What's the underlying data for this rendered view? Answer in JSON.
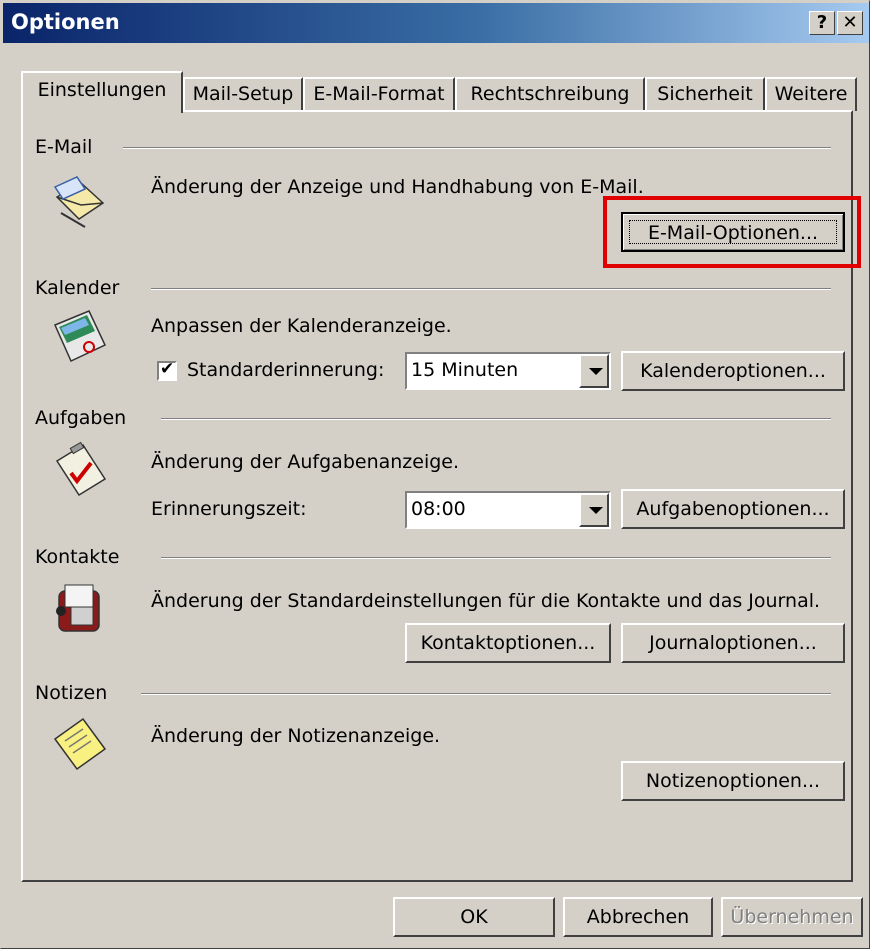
{
  "window": {
    "title": "Optionen",
    "help_label": "?",
    "close_label": "✕"
  },
  "tabs": [
    "Einstellungen",
    "Mail-Setup",
    "E-Mail-Format",
    "Rechtschreibung",
    "Sicherheit",
    "Weitere"
  ],
  "sections": {
    "email": {
      "label": "E-Mail",
      "description": "Änderung der Anzeige und Handhabung von E-Mail.",
      "button": "E-Mail-Optionen..."
    },
    "calendar": {
      "label": "Kalender",
      "description": "Anpassen der Kalenderanzeige.",
      "reminder_label": "Standarderinnerung:",
      "reminder_value": "15 Minuten",
      "button": "Kalenderoptionen..."
    },
    "tasks": {
      "label": "Aufgaben",
      "description": "Änderung der Aufgabenanzeige.",
      "reminder_label": "Erinnerungszeit:",
      "reminder_value": "08:00",
      "button": "Aufgabenoptionen..."
    },
    "contacts": {
      "label": "Kontakte",
      "description": "Änderung der Standardeinstellungen für die Kontakte und das Journal.",
      "contact_button": "Kontaktoptionen...",
      "journal_button": "Journaloptionen..."
    },
    "notes": {
      "label": "Notizen",
      "description": "Änderung der Notizenanzeige.",
      "button": "Notizenoptionen..."
    }
  },
  "footer": {
    "ok": "OK",
    "cancel": "Abbrechen",
    "apply": "Übernehmen"
  },
  "icons": [
    "email-icon",
    "calendar-icon",
    "tasks-icon",
    "contacts-icon",
    "notes-icon"
  ],
  "colors": {
    "dialog": "#d4d0c8",
    "title_start": "#0a246a",
    "highlight": "#e00000"
  }
}
